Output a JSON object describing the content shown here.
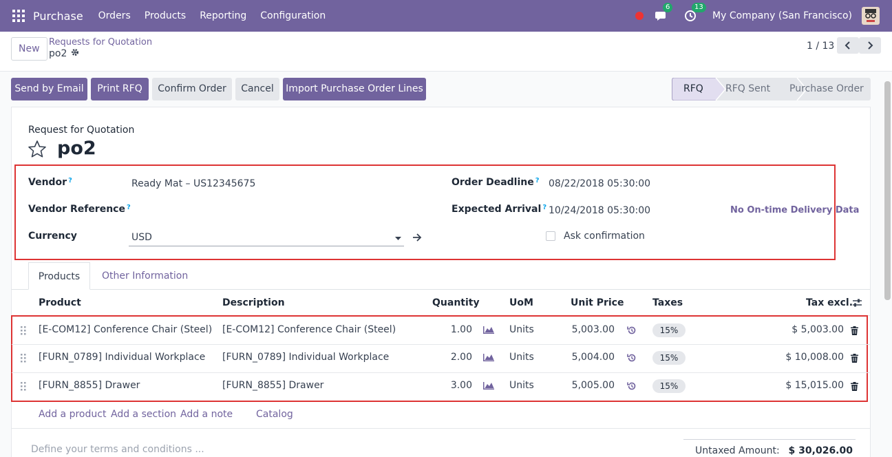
{
  "nav": {
    "app_name": "Purchase",
    "menu": [
      "Orders",
      "Products",
      "Reporting",
      "Configuration"
    ],
    "messages_count": "6",
    "activities_count": "13",
    "company": "My Company (San Francisco)"
  },
  "control": {
    "new_label": "New",
    "breadcrumb_parent": "Requests for Quotation",
    "breadcrumb_current": "po2",
    "pager": "1 / 13"
  },
  "actions": {
    "send_email": "Send by Email",
    "print_rfq": "Print RFQ",
    "confirm": "Confirm Order",
    "cancel": "Cancel",
    "import_lines": "Import Purchase Order Lines"
  },
  "statusbar": [
    "RFQ",
    "RFQ Sent",
    "Purchase Order"
  ],
  "form": {
    "doc_type": "Request for Quotation",
    "name": "po2",
    "vendor_label": "Vendor",
    "vendor_value": "Ready Mat – US12345675",
    "vendor_ref_label": "Vendor Reference",
    "currency_label": "Currency",
    "currency_value": "USD",
    "deadline_label": "Order Deadline",
    "deadline_value": "08/22/2018 05:30:00",
    "arrival_label": "Expected Arrival",
    "arrival_value": "10/24/2018 05:30:00",
    "ontime_label": "No On-time Delivery Data",
    "ask_confirmation": "Ask confirmation"
  },
  "tabs": [
    "Products",
    "Other Information"
  ],
  "table": {
    "headers": [
      "Product",
      "Description",
      "Quantity",
      "UoM",
      "Unit Price",
      "Taxes",
      "Tax excl."
    ],
    "rows": [
      {
        "product": "[E-COM12] Conference Chair (Steel)",
        "description": "[E-COM12] Conference Chair (Steel)",
        "qty": "1.00",
        "uom": "Units",
        "price": "5,003.00",
        "tax": "15%",
        "subtotal": "$ 5,003.00"
      },
      {
        "product": "[FURN_0789] Individual Workplace",
        "description": "[FURN_0789] Individual Workplace",
        "qty": "2.00",
        "uom": "Units",
        "price": "5,004.00",
        "tax": "15%",
        "subtotal": "$ 10,008.00"
      },
      {
        "product": "[FURN_8855] Drawer",
        "description": "[FURN_8855] Drawer",
        "qty": "3.00",
        "uom": "Units",
        "price": "5,005.00",
        "tax": "15%",
        "subtotal": "$ 15,015.00"
      }
    ],
    "add_product": "Add a product",
    "add_section": "Add a section",
    "add_note": "Add a note",
    "catalog": "Catalog"
  },
  "footer": {
    "terms_placeholder": "Define your terms and conditions ...",
    "untaxed_label": "Untaxed Amount:",
    "untaxed_value": "$ 30,026.00"
  },
  "colors": {
    "brand": "#71639e",
    "highlight": "#dd3333"
  }
}
